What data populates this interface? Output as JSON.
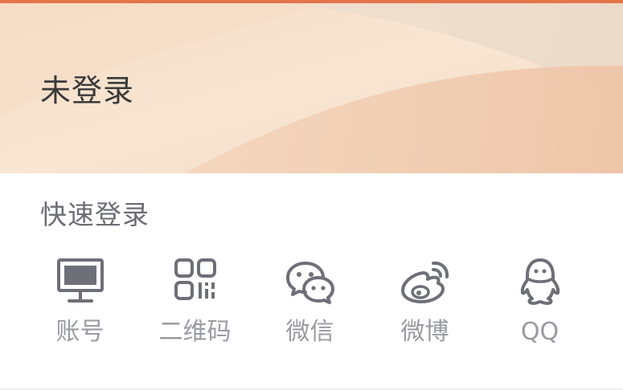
{
  "header": {
    "status_title": "未登录"
  },
  "quick_login": {
    "title": "快速登录",
    "options": [
      {
        "label": "账号",
        "icon": "monitor-icon"
      },
      {
        "label": "二维码",
        "icon": "qr-code-icon"
      },
      {
        "label": "微信",
        "icon": "wechat-icon"
      },
      {
        "label": "微博",
        "icon": "weibo-icon"
      },
      {
        "label": "QQ",
        "icon": "qq-penguin-icon"
      }
    ]
  },
  "colors": {
    "accent_line": "#e5734a",
    "header_gradient_light": "#f8e5d1",
    "header_gradient_dark": "#eecab0",
    "icon_gray": "#6f6f77",
    "label_gray": "#9a9aa2"
  }
}
